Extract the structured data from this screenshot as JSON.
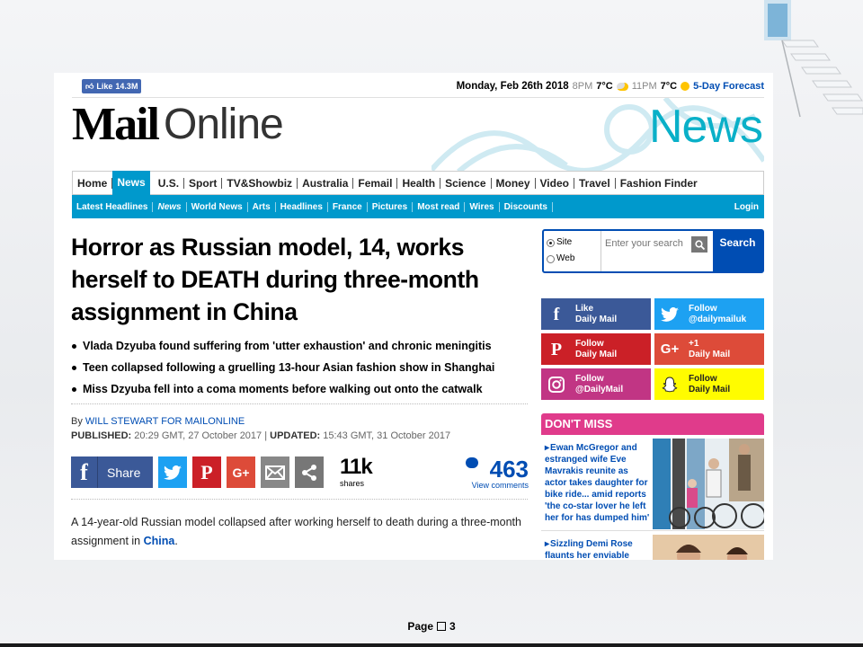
{
  "slide": {
    "page_label": "Page",
    "page_number": "3"
  },
  "topbar": {
    "like_label": "Like",
    "like_count": "14.3M",
    "date": "Monday, Feb 26th 2018",
    "time1": "8PM",
    "temp1": "7°C",
    "time2": "11PM",
    "temp2": "7°C",
    "forecast_link": "5-Day Forecast"
  },
  "logo": {
    "mail": "Mail",
    "online": "Online",
    "section": "News"
  },
  "nav": {
    "items": [
      "Home",
      "News",
      "U.S.",
      "Sport",
      "TV&Showbiz",
      "Australia",
      "Femail",
      "Health",
      "Science",
      "Money",
      "Video",
      "Travel",
      "Fashion Finder"
    ],
    "active": "News"
  },
  "subnav": {
    "items": [
      "Latest Headlines",
      "News",
      "World News",
      "Arts",
      "Headlines",
      "France",
      "Pictures",
      "Most read",
      "Wires",
      "Discounts"
    ],
    "login": "Login"
  },
  "article": {
    "headline": "Horror as Russian model, 14, works herself to DEATH during three-month assignment in China",
    "bullets": [
      "Vlada Dzyuba found suffering from 'utter exhaustion' and chronic meningitis",
      "Teen collapsed following a gruelling 13-hour Asian fashion show in Shanghai",
      "Miss Dzyuba fell into a coma moments before walking out onto the catwalk"
    ],
    "by_label": "By",
    "author": "WILL STEWART FOR MAILONLINE",
    "published_label": "PUBLISHED:",
    "published": "20:29 GMT, 27 October 2017",
    "updated_label": "UPDATED:",
    "updated": "15:43 GMT, 31 October 2017",
    "body_before": "A 14-year-old Russian model collapsed after working herself to death during a three-month assignment in ",
    "body_link": "China",
    "body_after": "."
  },
  "share": {
    "share_label": "Share",
    "shares_count": "11k",
    "shares_label": "shares",
    "comments_count": "463",
    "comments_label": "View comments"
  },
  "search": {
    "option_site": "Site",
    "option_web": "Web",
    "placeholder": "Enter your search",
    "button": "Search"
  },
  "follow": [
    {
      "line1": "Like",
      "line2": "Daily Mail",
      "icon": "facebook-icon",
      "glyph": "f"
    },
    {
      "line1": "Follow",
      "line2": "@dailymailuk",
      "icon": "twitter-icon",
      "glyph": ""
    },
    {
      "line1": "Follow",
      "line2": "Daily Mail",
      "icon": "pinterest-icon",
      "glyph": "P"
    },
    {
      "line1": "+1",
      "line2": "Daily Mail",
      "icon": "google-plus-icon",
      "glyph": "G+"
    },
    {
      "line1": "Follow",
      "line2": "@DailyMail",
      "icon": "instagram-icon",
      "glyph": ""
    },
    {
      "line1": "Follow",
      "line2": "Daily Mail",
      "icon": "snapchat-icon",
      "glyph": ""
    }
  ],
  "dont_miss": {
    "title": "DON'T MISS",
    "items": [
      "Ewan McGregor and estranged wife Eve Mavrakis reunite as actor takes daughter for bike ride... amid reports 'the co-star lover he left her for has dumped him'",
      "Sizzling Demi Rose flaunts her enviable"
    ]
  },
  "colors": {
    "accent": "#0099cc",
    "news_title": "#0ab0c8",
    "link": "#004db3",
    "dont_miss": "#e03b8b"
  }
}
